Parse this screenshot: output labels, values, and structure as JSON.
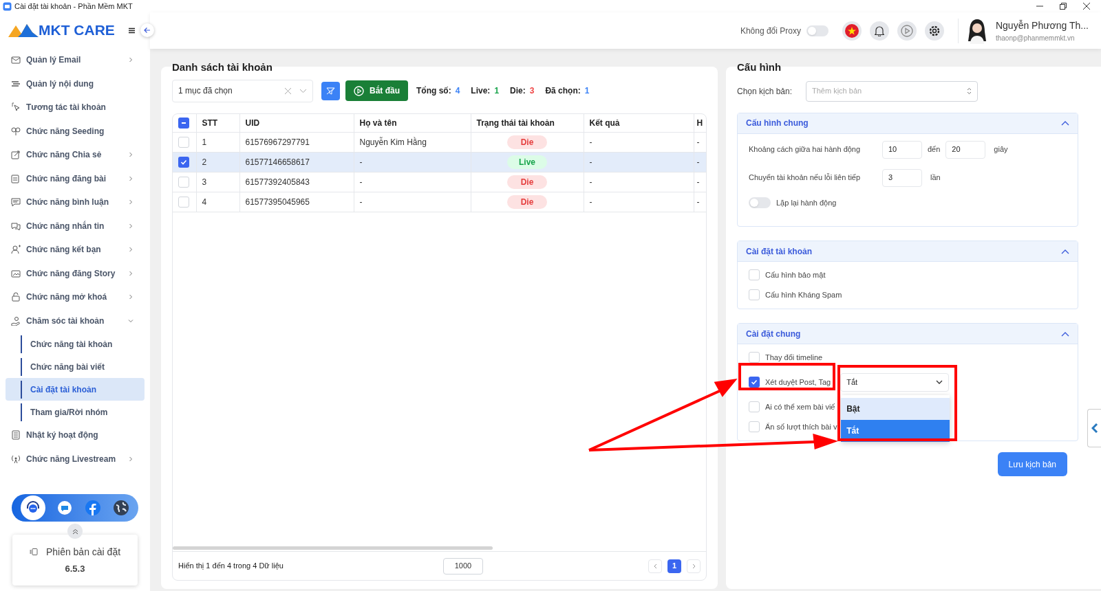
{
  "window": {
    "title": "Cài đặt tài khoản - Phần Mềm MKT"
  },
  "sidebar": {
    "logo": "MKT CARE",
    "items": [
      {
        "label": "Quản lý Email",
        "kind": "submenu",
        "selected": false
      },
      {
        "label": "Quản lý nội dung",
        "kind": "link",
        "selected": false
      },
      {
        "label": "Tương tác tài khoản",
        "kind": "link",
        "selected": false
      },
      {
        "label": "Chức năng Seeding",
        "kind": "link",
        "selected": false
      },
      {
        "label": "Chức năng Chia sẻ",
        "kind": "submenu",
        "selected": false
      },
      {
        "label": "Chức năng đăng bài",
        "kind": "submenu",
        "selected": false
      },
      {
        "label": "Chức năng bình luận",
        "kind": "submenu",
        "selected": false
      },
      {
        "label": "Chức năng nhắn tin",
        "kind": "submenu",
        "selected": false
      },
      {
        "label": "Chức năng kết bạn",
        "kind": "submenu",
        "selected": false
      },
      {
        "label": "Chức năng đăng Story",
        "kind": "submenu",
        "selected": false
      },
      {
        "label": "Chức năng mở khoá",
        "kind": "submenu",
        "selected": false
      },
      {
        "label": "Chăm sóc tài khoản",
        "kind": "submenu",
        "expanded": true,
        "selected": false,
        "children": [
          {
            "label": "Chức năng tài khoản",
            "selected": false
          },
          {
            "label": "Chức năng bài viết",
            "selected": false
          },
          {
            "label": "Cài đặt tài khoản",
            "selected": true
          },
          {
            "label": "Tham gia/Rời nhóm",
            "selected": false
          }
        ]
      },
      {
        "label": "Nhật ký hoạt động",
        "kind": "link",
        "selected": false
      },
      {
        "label": "Chức năng Livestream",
        "kind": "submenu",
        "selected": false
      }
    ],
    "version": {
      "label": "Phiên bản cài đặt",
      "value": "6.5.3"
    }
  },
  "header": {
    "proxy": {
      "label": "Không đổi Proxy",
      "on": false
    },
    "user": {
      "name": "Nguyễn Phương Th...",
      "email": "thaonp@phanmemmkt.vn"
    }
  },
  "accounts": {
    "title": "Danh sách tài khoản",
    "select": {
      "value": "1 mục đã chọn"
    },
    "start_button": "Bắt đầu",
    "stats": [
      {
        "label": "Tổng số:",
        "value": "4",
        "color": "#3b82f6"
      },
      {
        "label": "Live:",
        "value": "1",
        "color": "#16a34a"
      },
      {
        "label": "Die:",
        "value": "3",
        "color": "#ef4444"
      },
      {
        "label": "Đã chọn:",
        "value": "1",
        "color": "#3b82f6"
      }
    ],
    "table": {
      "header_checkbox": {
        "indeterminate": true
      },
      "columns": [
        "STT",
        "UID",
        "Họ và tên",
        "Trạng thái tài khoản",
        "Kết quả",
        "H"
      ],
      "rows": [
        {
          "selected": false,
          "stt": "1",
          "uid": "61576967297791",
          "name": "Nguyễn Kim Hằng",
          "status": {
            "text": "Die",
            "kind": "die"
          },
          "result": "-",
          "column_6": "-"
        },
        {
          "selected": true,
          "stt": "2",
          "uid": "61577146658617",
          "name": "-",
          "status": {
            "text": "Live",
            "kind": "live"
          },
          "result": "-",
          "column_6": "-"
        },
        {
          "selected": false,
          "stt": "3",
          "uid": "61577392405843",
          "name": "-",
          "status": {
            "text": "Die",
            "kind": "die"
          },
          "result": "-",
          "column_6": "-"
        },
        {
          "selected": false,
          "stt": "4",
          "uid": "61577395045965",
          "name": "-",
          "status": {
            "text": "Die",
            "kind": "die"
          },
          "result": "-",
          "column_6": "-"
        }
      ]
    },
    "footer": {
      "summary": "Hiển thị 1 đến 4 trong 4 Dữ liệu",
      "page_size": "1000",
      "pages": [
        {
          "label": "1",
          "selected": true
        }
      ]
    }
  },
  "config": {
    "title": "Cấu hình",
    "script_select": {
      "label": "Chọn kịch bản:",
      "placeholder": "Thêm kịch bản"
    },
    "sections": [
      {
        "title": "Cấu hình chung",
        "expanded": true,
        "items": [
          {
            "kind": "range",
            "label": "Khoảng cách giữa hai hành động",
            "from": "10",
            "to_label": "đến",
            "to": "20",
            "unit": "giây"
          },
          {
            "kind": "number",
            "label": "Chuyển tài khoản nếu lỗi liên tiếp",
            "value": "3",
            "unit": "lần"
          },
          {
            "kind": "toggle",
            "label": "Lặp lại hành động",
            "on": false
          }
        ]
      },
      {
        "title": "Cài đặt tài khoản",
        "expanded": true,
        "items": [
          {
            "kind": "checkbox",
            "label": "Cấu hình bảo mật",
            "checked": false
          },
          {
            "kind": "checkbox",
            "label": "Cấu hình Kháng Spam",
            "checked": false
          }
        ]
      },
      {
        "title": "Cài đặt chung",
        "expanded": true,
        "items": [
          {
            "kind": "checkbox",
            "label": "Thay đổi timeline",
            "checked": false
          },
          {
            "kind": "checkbox",
            "label": "Xét duyệt Post, Tag",
            "checked": true,
            "select": {
              "value": "Tắt",
              "open": true,
              "options": [
                {
                  "label": "Bật",
                  "selected": false,
                  "highlighted": true
                },
                {
                  "label": "Tắt",
                  "selected": true,
                  "highlighted": false
                }
              ]
            }
          },
          {
            "kind": "checkbox",
            "label": "Ai có thể xem bài viế",
            "checked": false
          },
          {
            "kind": "checkbox",
            "label": "Ẩn số lượt thích bài v",
            "checked": false
          }
        ]
      }
    ],
    "save_button": "Lưu kịch bản"
  }
}
